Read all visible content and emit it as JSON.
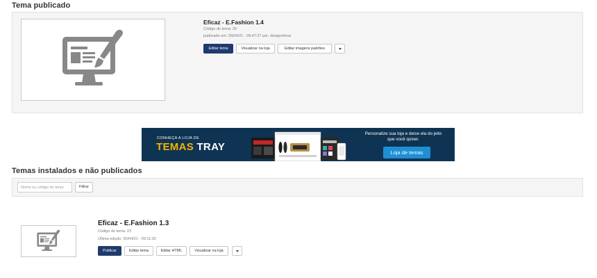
{
  "published": {
    "section_title": "Tema publicado",
    "theme_name": "Eficaz - E.Fashion 1.4",
    "code_line": "Código do tema: 25",
    "published_line": "publicado em: 26/04/21 - 09:47:27 por: designeficaz",
    "buttons": {
      "edit": "Editar tema",
      "view": "Visualizar na loja",
      "edit_images": "Editar imagens padrões"
    }
  },
  "banner": {
    "kicker": "CONHEÇA A LOJA DE",
    "word1": "TEMAS",
    "word2": "TRAY",
    "tagline": "Personalize sua loja e deixe ela do jeito que você quiser.",
    "button": "Loja de temas"
  },
  "installed": {
    "section_title": "Temas instalados e não publicados",
    "filter": {
      "placeholder": "Nome ou código do tema",
      "button": "Filtrar"
    },
    "items": [
      {
        "theme_name": "Eficaz - E.Fashion 1.3",
        "code_line": "Código do tema: 23",
        "edited_line": "Última edição: 20/04/21 - 09:11:30",
        "buttons": {
          "publish": "Publicar",
          "edit": "Editar tema",
          "edit_html": "Editar HTML",
          "view": "Visualizar na loja"
        }
      }
    ]
  },
  "colors": {
    "primary": "#1f3a6e",
    "banner_bg": "#0f3352",
    "banner_accent": "#f5b400",
    "banner_button": "#1e8fd5",
    "icon": "#888888"
  },
  "icons": {
    "theme_thumbnail": "monitor-paintbrush-icon",
    "dropdown": "caret-down-icon"
  }
}
